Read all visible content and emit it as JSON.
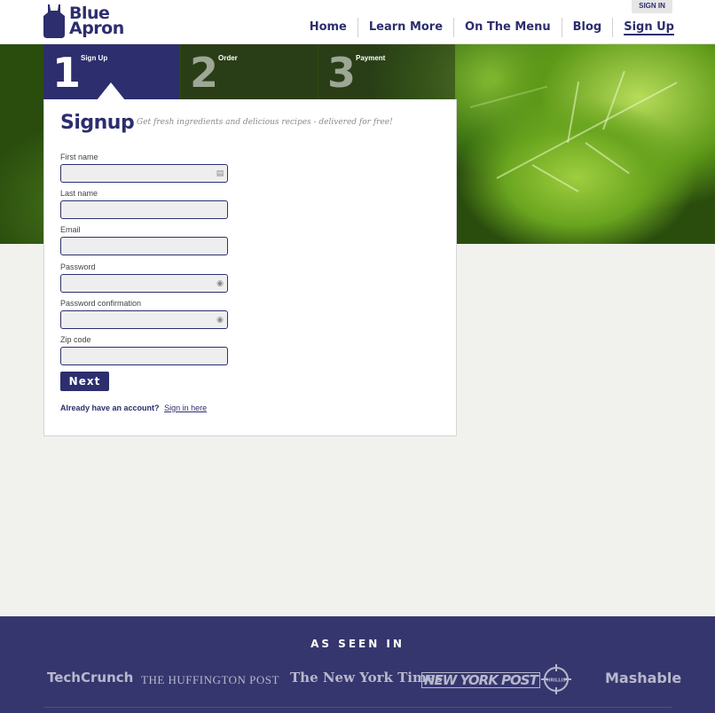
{
  "header": {
    "brand_line1": "Blue",
    "brand_line2": "Apron",
    "sign_in": "SIGN IN",
    "nav": [
      "Home",
      "Learn More",
      "On The Menu",
      "Blog",
      "Sign Up"
    ]
  },
  "steps": [
    {
      "number": "1",
      "label": "Sign Up"
    },
    {
      "number": "2",
      "label": "Order"
    },
    {
      "number": "3",
      "label": "Payment"
    }
  ],
  "form": {
    "title": "Signup",
    "tagline": "Get fresh ingredients and delicious recipes - delivered for free!",
    "fields": [
      {
        "label": "First name",
        "value": ""
      },
      {
        "label": "Last name",
        "value": ""
      },
      {
        "label": "Email",
        "value": ""
      },
      {
        "label": "Password",
        "value": ""
      },
      {
        "label": "Password confirmation",
        "value": ""
      },
      {
        "label": "Zip code",
        "value": ""
      }
    ],
    "next_button": "Next",
    "account_question": "Already have an account?",
    "sign_in_link": "Sign in here"
  },
  "footer": {
    "seen_in": "AS SEEN IN",
    "press": [
      "TechCrunch",
      "THE HUFFINGTON POST",
      "The New York Times",
      "NEW YORK POST",
      "THRILLIST",
      "Mashable"
    ]
  },
  "colors": {
    "brand": "#2c2e6e",
    "footer_bg": "#36366e",
    "page_bg": "#f1f1ee"
  }
}
